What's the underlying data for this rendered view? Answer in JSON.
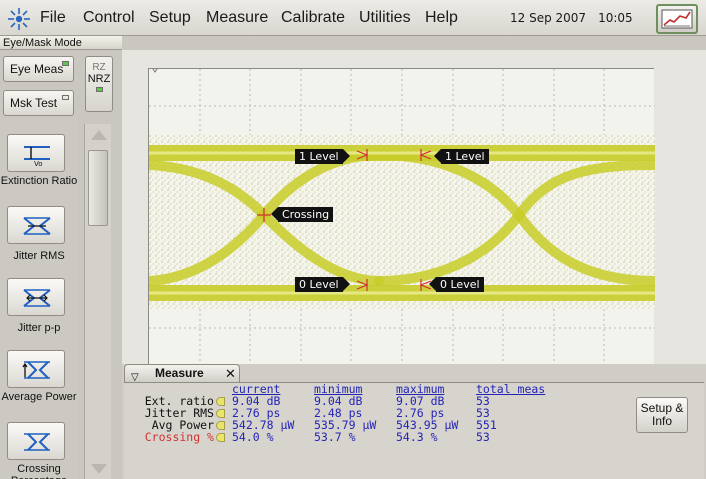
{
  "menu": {
    "items": [
      "File",
      "Control",
      "Setup",
      "Measure",
      "Calibrate",
      "Utilities",
      "Help"
    ],
    "underlines": [
      "F",
      "C",
      "S",
      "M",
      "C",
      "U",
      "H"
    ],
    "date": "12 Sep 2007",
    "time": "10:05"
  },
  "mode": {
    "title": "Eye/Mask Mode",
    "eye_meas": "Eye Meas",
    "mask_test": "Msk Test",
    "rz": "RZ",
    "nrz": "NRZ"
  },
  "measurements_toolbar": [
    {
      "label": "Extinction Ratio",
      "icon": "extinction-ratio-icon"
    },
    {
      "label": "Jitter RMS",
      "icon": "jitter-rms-icon"
    },
    {
      "label": "Jitter p-p",
      "icon": "jitter-pp-icon"
    },
    {
      "label": "Average Power",
      "icon": "average-power-icon"
    },
    {
      "label": "Crossing Percentage",
      "icon": "crossing-percentage-icon"
    }
  ],
  "scope": {
    "markers": {
      "one_level": "1 Level",
      "zero_level": "0 Level",
      "crossing": "Crossing"
    },
    "trace_color": "#c8cc28"
  },
  "measure_window": {
    "title": "Measure",
    "headers": {
      "current": "current",
      "minimum": "minimum",
      "maximum": "maximum",
      "total": "total meas"
    },
    "rows": [
      {
        "name": "Ext. ratio",
        "current": "9.04 dB",
        "minimum": "9.04 dB",
        "maximum": "9.07 dB",
        "total": "53"
      },
      {
        "name": "Jitter RMS",
        "current": "2.76 ps",
        "minimum": "2.48 ps",
        "maximum": "2.76 ps",
        "total": "53"
      },
      {
        "name": "Avg Power",
        "current": "542.78 µW",
        "minimum": "535.79 µW",
        "maximum": "543.95 µW",
        "total": "551"
      },
      {
        "name": "Crossing %",
        "current": "54.0 %",
        "minimum": "53.7 %",
        "maximum": "54.3 %",
        "total": "53"
      }
    ],
    "setup_button": "Setup & Info"
  }
}
